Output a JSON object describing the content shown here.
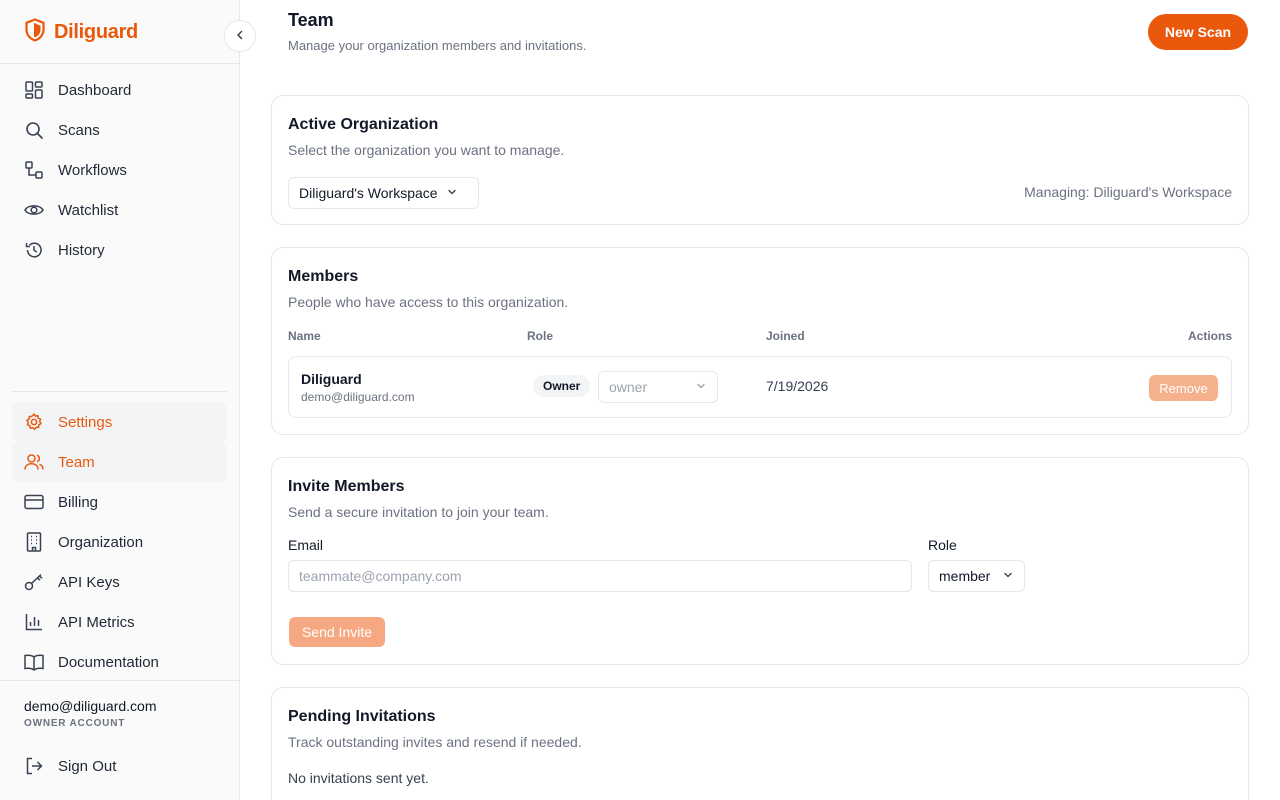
{
  "brand": {
    "name": "Diliguard",
    "logo_icon": "shield-icon",
    "accent": "#ea580c"
  },
  "sidebar": {
    "collapse_icon": "chevron-left-icon",
    "main_items": [
      {
        "label": "Dashboard",
        "icon": "dashboard-icon"
      },
      {
        "label": "Scans",
        "icon": "search-icon"
      },
      {
        "label": "Workflows",
        "icon": "workflow-icon"
      },
      {
        "label": "Watchlist",
        "icon": "eye-icon"
      },
      {
        "label": "History",
        "icon": "history-icon"
      }
    ],
    "bottom_items": [
      {
        "label": "Settings",
        "icon": "gear-icon",
        "active": true
      },
      {
        "label": "Team",
        "icon": "users-icon",
        "active": true
      },
      {
        "label": "Billing",
        "icon": "credit-card-icon"
      },
      {
        "label": "Organization",
        "icon": "building-icon"
      },
      {
        "label": "API Keys",
        "icon": "key-icon"
      },
      {
        "label": "API Metrics",
        "icon": "bar-chart-icon"
      },
      {
        "label": "Documentation",
        "icon": "book-icon"
      }
    ],
    "user": {
      "email": "demo@diliguard.com",
      "role": "OWNER ACCOUNT"
    },
    "sign_out": {
      "label": "Sign Out",
      "icon": "logout-icon"
    }
  },
  "header": {
    "title": "Team",
    "subtitle": "Manage your organization members and invitations.",
    "new_scan_label": "New Scan"
  },
  "active_org": {
    "title": "Active Organization",
    "description": "Select the organization you want to manage.",
    "selected": "Diliguard's Workspace",
    "managing_text": "Managing: Diliguard's Workspace"
  },
  "members": {
    "title": "Members",
    "description": "People who have access to this organization.",
    "columns": {
      "name": "Name",
      "role": "Role",
      "joined": "Joined",
      "actions": "Actions"
    },
    "rows": [
      {
        "name": "Diliguard",
        "email": "demo@diliguard.com",
        "badge": "Owner",
        "role": "owner",
        "joined": "7/19/2026",
        "action": "Remove"
      }
    ]
  },
  "invite": {
    "title": "Invite Members",
    "description": "Send a secure invitation to join your team.",
    "email_label": "Email",
    "email_placeholder": "teammate@company.com",
    "email_value": "",
    "role_label": "Role",
    "role_value": "member",
    "send_label": "Send Invite"
  },
  "pending": {
    "title": "Pending Invitations",
    "description": "Track outstanding invites and resend if needed.",
    "empty_text": "No invitations sent yet."
  }
}
